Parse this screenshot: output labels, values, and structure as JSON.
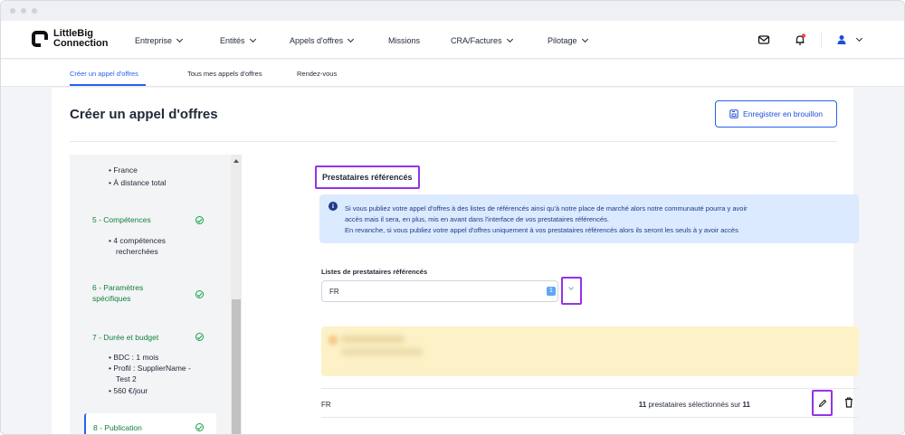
{
  "navbar": {
    "logo_line1": "LittleBig",
    "logo_line2": "Connection",
    "items": [
      {
        "label": "Entreprise"
      },
      {
        "label": "Entités"
      },
      {
        "label": "Appels d'offres"
      },
      {
        "label": "Missions"
      },
      {
        "label": "CRA/Factures"
      },
      {
        "label": "Pilotage"
      }
    ],
    "icons": [
      "mail-icon",
      "bell-icon",
      "user-icon"
    ],
    "notification_color": "#ef4444"
  },
  "subnav": {
    "tabs": [
      {
        "label": "Créer un appel d'offres",
        "active": true
      },
      {
        "label": "Tous mes appels d'offres",
        "active": false
      },
      {
        "label": "Rendez-vous",
        "active": false
      }
    ]
  },
  "page": {
    "title": "Créer un appel d'offres",
    "draft_button": "Enregistrer en brouillon"
  },
  "sidebar": {
    "location_items": [
      "France",
      "À distance total"
    ],
    "steps": [
      {
        "label": "5 - Compétences",
        "details": [
          "4 compétences",
          "recherchées"
        ]
      },
      {
        "label_line1": "6 - Paramètres",
        "label_line2": "spécifiques"
      },
      {
        "label": "7 - Durée et budget",
        "details": [
          "BDC : 1 mois",
          "Profil : SupplierName -",
          "Test 2",
          "560 €/jour"
        ]
      },
      {
        "label": "8 - Publication",
        "active": true
      }
    ]
  },
  "main": {
    "section_title": "Prestataires référencés",
    "info": {
      "line1": "Si vous publiez votre appel d'offres à des listes de référencés ainsi qu'à notre place de marché alors notre communauté pourra y avoir",
      "line2": "accès mais il sera, en plus, mis en avant dans l'interface de vos prestataires référencés.",
      "line3": "En revanche, si vous publiez votre appel d'offres uniquement à vos prestataires référencés alors ils seront les seuls à y avoir accès"
    },
    "list_label": "Listes de prestataires référencés",
    "selected_list": "FR",
    "selected_count": "1",
    "row": {
      "name": "FR",
      "count_selected": "11",
      "count_text": " prestataires sélectionnés sur ",
      "count_total": "11"
    }
  },
  "colors": {
    "accent": "#2563eb",
    "highlight": "#9333ea",
    "success": "#16a34a",
    "info_bg": "#dbeafe",
    "warning_bg": "#fdf1c7"
  }
}
